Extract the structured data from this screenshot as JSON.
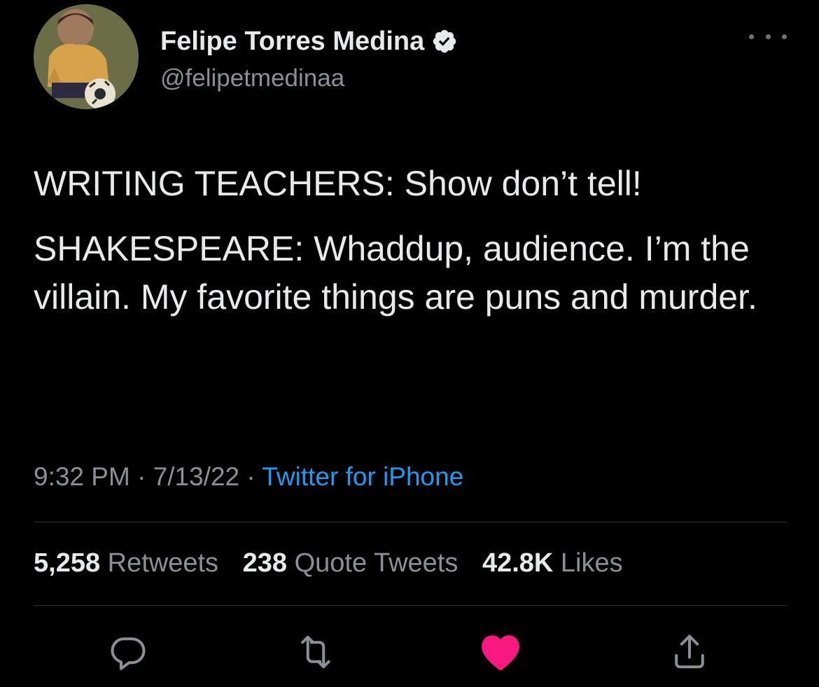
{
  "user": {
    "display_name": "Felipe Torres Medina",
    "handle": "@felipetmedinaa",
    "verified": true,
    "avatar_icon": "avatar-photo"
  },
  "tweet": {
    "paragraph_1": "WRITING TEACHERS: Show don’t tell!",
    "paragraph_2": "SHAKESPEARE: Whaddup, audience. I’m the villain. My favorite things are puns and murder."
  },
  "meta": {
    "time": "9:32 PM",
    "separator": "·",
    "date": "7/13/22",
    "source": "Twitter for iPhone"
  },
  "stats": {
    "retweets_count": "5,258",
    "retweets_label": "Retweets",
    "quotes_count": "238",
    "quotes_label": "Quote Tweets",
    "likes_count": "42.8K",
    "likes_label": "Likes"
  },
  "actions": {
    "reply_icon": "reply-icon",
    "retweet_icon": "retweet-icon",
    "like_icon": "heart-icon",
    "share_icon": "share-icon",
    "liked": true
  },
  "colors": {
    "background": "#000000",
    "text": "#e7e9ea",
    "secondary": "#8b9096",
    "link": "#1d9bf0",
    "like": "#f91880",
    "divider": "#2f3336"
  }
}
